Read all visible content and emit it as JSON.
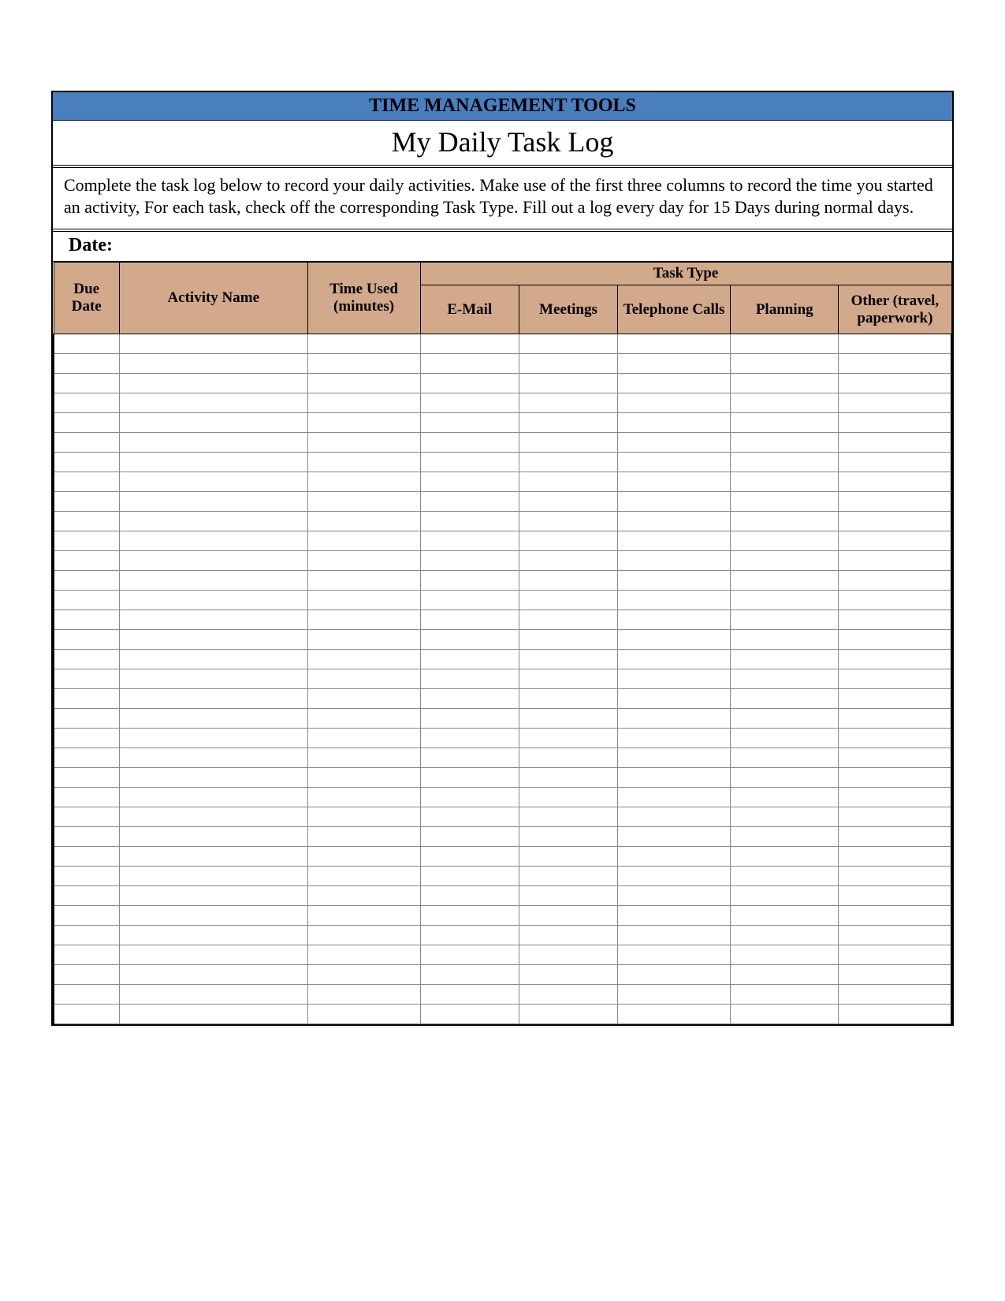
{
  "header": {
    "banner": "TIME MANAGEMENT TOOLS",
    "title": "My Daily Task Log"
  },
  "instructions": "Complete the task log below to record your daily activities. Make use of the first three columns to record the time you started an activity, For each task, check off the corresponding Task Type. Fill out a log every day for 15 Days during normal days.",
  "date_label": "Date:",
  "columns": {
    "due_date": "Due Date",
    "activity_name": "Activity Name",
    "time_used": "Time Used (minutes)",
    "task_type_header": "Task Type",
    "email": "E-Mail",
    "meetings": "Meetings",
    "telephone": "Telephone Calls",
    "planning": "Planning",
    "other": "Other (travel, paperwork)"
  },
  "row_count": 35
}
